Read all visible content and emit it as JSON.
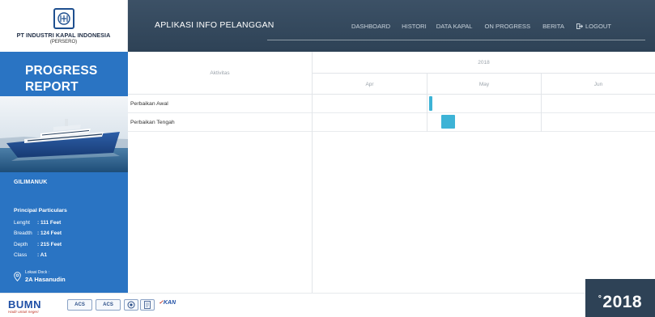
{
  "brand": {
    "company_name": "PT INDUSTRI KAPAL INDONESIA",
    "company_sub": "(PERSERO)"
  },
  "header": {
    "app_title": "APLIKASI INFO PELANGGAN",
    "nav": [
      {
        "label": "DASHBOARD"
      },
      {
        "label": "HISTORI"
      },
      {
        "label": "DATA KAPAL"
      },
      {
        "label": "ON PROGRESS"
      },
      {
        "label": "BERITA"
      },
      {
        "label": "LOGOUT"
      }
    ]
  },
  "sidebar": {
    "report_title_line1": "PROGRESS",
    "report_title_line2": "REPORT",
    "ship_name": "GILIMANUK",
    "particulars_title": "Principal Particulars",
    "particulars": [
      {
        "label": "Lenght",
        "value": ": 111 Feet"
      },
      {
        "label": "Breadth",
        "value": ": 124 Feet"
      },
      {
        "label": "Depth",
        "value": ": 215 Feet"
      },
      {
        "label": "Class",
        "value": ": A1"
      }
    ],
    "dock_label": "Lokasi Dock :",
    "dock_name": "2A Hasanudin"
  },
  "gantt": {
    "activity_header": "Aktivitas",
    "year": "2018",
    "months": [
      "Apr",
      "May",
      "Jun"
    ],
    "rows": [
      {
        "label": "Perbaikan Awal",
        "start_month": 1.02,
        "end_month": 1.05,
        "color": "#3db3d6"
      },
      {
        "label": "Perbaikan Tengah",
        "start_month": 1.13,
        "end_month": 1.25,
        "color": "#3db3d6"
      }
    ]
  },
  "footer": {
    "bumn_word": "BUMN",
    "bumn_tag": "Hadir untuk negeri",
    "certs": [
      "ACS",
      "ACS",
      "KAN"
    ],
    "year_badge": "2018",
    "year_badge_deg": "°"
  },
  "colors": {
    "sidebar": "#2a74c3",
    "topbar": "#2e4256",
    "bar": "#3db3d6"
  }
}
